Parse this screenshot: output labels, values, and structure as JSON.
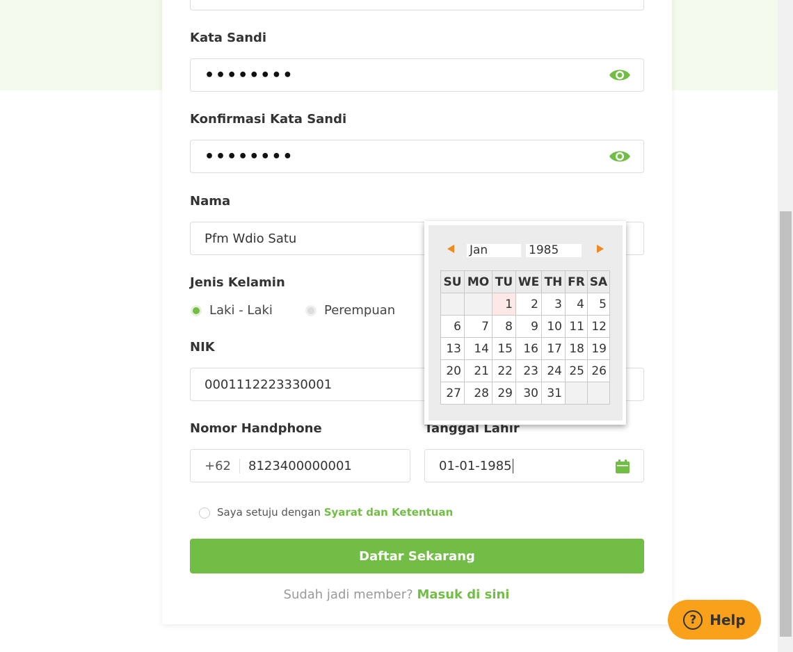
{
  "form": {
    "password_label": "Kata Sandi",
    "password_value": "••••••••",
    "confirm_label": "Konfirmasi Kata Sandi",
    "confirm_value": "••••••••",
    "name_label": "Nama",
    "name_value": "Pfm Wdio Satu",
    "gender_label": "Jenis Kelamin",
    "gender_options": [
      "Laki - Laki",
      "Perempuan"
    ],
    "gender_selected": "Laki - Laki",
    "nik_label": "NIK",
    "nik_value": "0001112223330001",
    "phone_label": "Nomor Handphone",
    "phone_prefix": "+62",
    "phone_value": "8123400000001",
    "dob_label": "Tanggal Lahir",
    "dob_value": "01-01-1985",
    "agree_text": "Saya setuju dengan",
    "agree_link": "Syarat dan Ketentuan",
    "submit_label": "Daftar Sekarang",
    "login_text": "Sudah jadi member?",
    "login_link": "Masuk di sini"
  },
  "help": {
    "label": "Help",
    "glyph": "?"
  },
  "datepicker": {
    "month": "Jan",
    "year": "1985",
    "weekdays": [
      "SU",
      "MO",
      "TU",
      "WE",
      "TH",
      "FR",
      "SA"
    ],
    "weeks": [
      [
        "",
        "",
        "1",
        "2",
        "3",
        "4",
        "5"
      ],
      [
        "6",
        "7",
        "8",
        "9",
        "10",
        "11",
        "12"
      ],
      [
        "13",
        "14",
        "15",
        "16",
        "17",
        "18",
        "19"
      ],
      [
        "20",
        "21",
        "22",
        "23",
        "24",
        "25",
        "26"
      ],
      [
        "27",
        "28",
        "29",
        "30",
        "31",
        "",
        ""
      ]
    ],
    "highlighted_day": "1"
  },
  "colors": {
    "accent": "#72bd45",
    "help": "#f9a11b",
    "arrow": "#f18a1e"
  }
}
